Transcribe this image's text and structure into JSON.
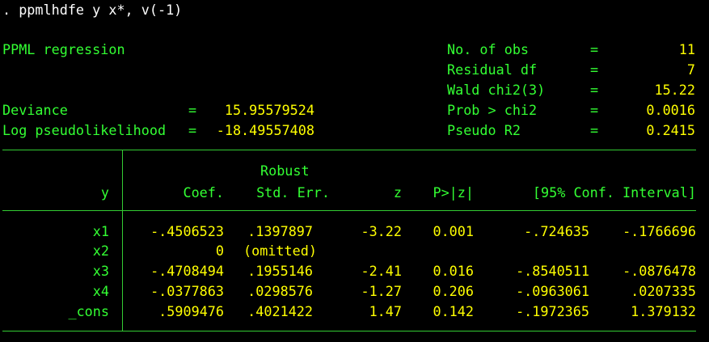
{
  "command": ". ppmlhdfe y x*, v(-1)",
  "header": {
    "title": "PPML regression",
    "left": [
      {
        "label": "Deviance",
        "eq": "=",
        "value": "15.95579524"
      },
      {
        "label": "Log pseudolikelihood",
        "eq": "=",
        "value": "-18.49557408"
      }
    ],
    "right": [
      {
        "label": "No. of obs",
        "eq": "=",
        "value": "11"
      },
      {
        "label": "Residual df",
        "eq": "=",
        "value": "7"
      },
      {
        "label": "Wald chi2(3)",
        "eq": "=",
        "value": "15.22"
      },
      {
        "label": "Prob > chi2",
        "eq": "=",
        "value": "0.0016"
      },
      {
        "label": "Pseudo R2",
        "eq": "=",
        "value": "0.2415"
      }
    ]
  },
  "table": {
    "robust_label": "Robust",
    "columns": [
      "y",
      "Coef.",
      "Std. Err.",
      "z",
      "P>|z|",
      "[95% Conf. Interval]"
    ],
    "rows": [
      {
        "var": "x1",
        "coef": "-.4506523",
        "se": ".1397897",
        "z": "-3.22",
        "p": "0.001",
        "lo": "-.724635",
        "hi": "-.1766696"
      },
      {
        "var": "x2",
        "coef": "0",
        "se": "(omitted)",
        "z": "",
        "p": "",
        "lo": "",
        "hi": ""
      },
      {
        "var": "x3",
        "coef": "-.4708494",
        "se": ".1955146",
        "z": "-2.41",
        "p": "0.016",
        "lo": "-.8540511",
        "hi": "-.0876478"
      },
      {
        "var": "x4",
        "coef": "-.0377863",
        "se": ".0298576",
        "z": "-1.27",
        "p": "0.206",
        "lo": "-.0963061",
        "hi": ".0207335"
      },
      {
        "var": "_cons",
        "coef": ".5909476",
        "se": ".4021422",
        "z": "1.47",
        "p": "0.142",
        "lo": "-.1972365",
        "hi": "1.379132"
      }
    ]
  }
}
